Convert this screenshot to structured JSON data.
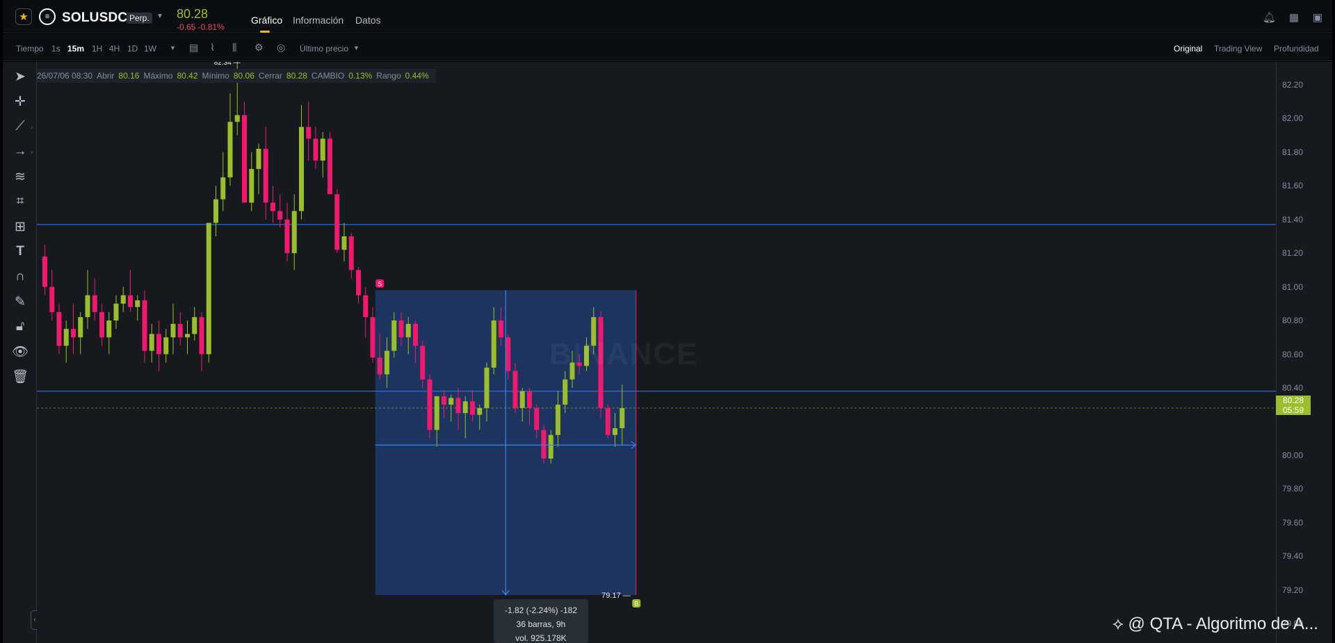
{
  "header": {
    "symbol": "SOLUSDC",
    "perp_label": "Perp.",
    "last_price": "80.28",
    "change": "-0.65 -0.81%",
    "tabs": [
      "Gráfico",
      "Información",
      "Datos"
    ]
  },
  "toolbar": {
    "time_label": "Tiempo",
    "intervals": [
      "1s",
      "15m",
      "1H",
      "4H",
      "1D",
      "1W"
    ],
    "active_interval": "15m",
    "price_type": "Último precio",
    "views": [
      "Original",
      "Trading View",
      "Profundidad"
    ],
    "active_view": "Original"
  },
  "legend": {
    "datetime": "26/07/06 08:30",
    "open_label": "Abrir",
    "open": "80.16",
    "high_label": "Máximo",
    "high": "80.42",
    "low_label": "Mínimo",
    "low": "80.06",
    "close_label": "Cerrar",
    "close": "80.28",
    "change_label": "CAMBIO",
    "change": "0.13%",
    "range_label": "Rango",
    "range": "0.44%"
  },
  "price_axis": {
    "ticks": [
      "82.20",
      "82.00",
      "81.80",
      "81.60",
      "81.40",
      "81.20",
      "81.00",
      "80.80",
      "80.60",
      "80.40",
      "80.00",
      "79.80",
      "79.60",
      "79.40",
      "79.20",
      "79.00"
    ],
    "current_price": "80.28",
    "countdown": "05:59"
  },
  "chart_data": {
    "type": "candlestick",
    "symbol": "SOLUSDC",
    "interval": "15m",
    "ylim": [
      79.0,
      82.3
    ],
    "colors": {
      "up": "#9bbf2a",
      "down": "#f0196e",
      "line": "#2f6bd6",
      "box": "#1f3a6b"
    },
    "candles": [
      [
        81.18,
        81.25,
        80.95,
        81.0
      ],
      [
        81.0,
        81.1,
        80.8,
        80.85
      ],
      [
        80.85,
        80.9,
        80.6,
        80.65
      ],
      [
        80.65,
        80.8,
        80.55,
        80.75
      ],
      [
        80.75,
        80.9,
        80.6,
        80.7
      ],
      [
        80.7,
        80.85,
        80.6,
        80.82
      ],
      [
        80.82,
        81.1,
        80.75,
        80.95
      ],
      [
        80.95,
        81.05,
        80.8,
        80.85
      ],
      [
        80.85,
        80.9,
        80.65,
        80.7
      ],
      [
        80.7,
        80.85,
        80.6,
        80.8
      ],
      [
        80.8,
        80.95,
        80.75,
        80.9
      ],
      [
        80.9,
        81.0,
        80.85,
        80.95
      ],
      [
        80.95,
        81.1,
        80.85,
        80.88
      ],
      [
        80.88,
        80.95,
        80.8,
        80.92
      ],
      [
        80.92,
        80.98,
        80.55,
        80.62
      ],
      [
        80.62,
        80.78,
        80.55,
        80.72
      ],
      [
        80.72,
        80.8,
        80.5,
        80.6
      ],
      [
        80.6,
        80.75,
        80.55,
        80.7
      ],
      [
        80.7,
        80.9,
        80.6,
        80.78
      ],
      [
        80.78,
        80.85,
        80.65,
        80.7
      ],
      [
        80.7,
        80.8,
        80.6,
        80.72
      ],
      [
        80.72,
        80.88,
        80.68,
        80.82
      ],
      [
        80.82,
        80.85,
        80.5,
        80.6
      ],
      [
        80.6,
        81.0,
        80.55,
        81.38
      ],
      [
        81.38,
        81.6,
        81.3,
        81.52
      ],
      [
        81.52,
        81.8,
        81.45,
        81.65
      ],
      [
        81.65,
        82.15,
        81.6,
        81.98
      ],
      [
        81.98,
        82.34,
        81.9,
        82.02
      ],
      [
        82.02,
        82.1,
        81.5,
        81.5
      ],
      [
        81.5,
        81.8,
        81.45,
        81.7
      ],
      [
        81.7,
        81.85,
        81.55,
        81.82
      ],
      [
        81.82,
        81.95,
        81.4,
        81.5
      ],
      [
        81.5,
        81.6,
        81.38,
        81.45
      ],
      [
        81.45,
        81.55,
        81.35,
        81.4
      ],
      [
        81.4,
        81.5,
        81.15,
        81.2
      ],
      [
        81.2,
        81.55,
        81.1,
        81.45
      ],
      [
        81.45,
        82.08,
        81.4,
        81.95
      ],
      [
        81.95,
        82.1,
        81.75,
        81.88
      ],
      [
        81.88,
        81.95,
        81.7,
        81.75
      ],
      [
        81.75,
        81.92,
        81.65,
        81.88
      ],
      [
        81.88,
        81.92,
        81.55,
        81.55
      ],
      [
        81.55,
        81.58,
        81.2,
        81.22
      ],
      [
        81.22,
        81.38,
        81.15,
        81.3
      ],
      [
        81.3,
        81.32,
        81.05,
        81.1
      ],
      [
        81.1,
        81.12,
        80.9,
        80.95
      ],
      [
        80.95,
        81.0,
        80.7,
        80.82
      ],
      [
        80.82,
        80.88,
        80.55,
        80.58
      ],
      [
        80.58,
        80.72,
        80.45,
        80.48
      ],
      [
        80.48,
        80.7,
        80.4,
        80.62
      ],
      [
        80.62,
        80.85,
        80.58,
        80.8
      ],
      [
        80.8,
        80.85,
        80.65,
        80.7
      ],
      [
        80.7,
        80.82,
        80.6,
        80.78
      ],
      [
        80.78,
        80.8,
        80.55,
        80.65
      ],
      [
        80.65,
        80.68,
        80.4,
        80.45
      ],
      [
        80.45,
        80.48,
        80.1,
        80.15
      ],
      [
        80.15,
        80.35,
        80.05,
        80.35
      ],
      [
        80.35,
        80.38,
        80.22,
        80.3
      ],
      [
        80.3,
        80.36,
        80.2,
        80.34
      ],
      [
        80.34,
        80.4,
        80.15,
        80.25
      ],
      [
        80.25,
        80.35,
        80.1,
        80.32
      ],
      [
        80.32,
        80.38,
        80.2,
        80.24
      ],
      [
        80.24,
        80.3,
        80.15,
        80.28
      ],
      [
        80.28,
        80.55,
        80.2,
        80.52
      ],
      [
        80.52,
        80.88,
        80.48,
        80.8
      ],
      [
        80.8,
        80.88,
        80.65,
        80.7
      ],
      [
        80.7,
        80.72,
        80.45,
        80.5
      ],
      [
        80.5,
        80.55,
        80.25,
        80.28
      ],
      [
        80.28,
        80.4,
        80.2,
        80.38
      ],
      [
        80.38,
        80.4,
        80.18,
        80.28
      ],
      [
        80.28,
        80.3,
        80.1,
        80.15
      ],
      [
        80.15,
        80.18,
        79.95,
        79.98
      ],
      [
        79.98,
        80.15,
        79.95,
        80.12
      ],
      [
        80.12,
        80.38,
        80.05,
        80.3
      ],
      [
        80.3,
        80.5,
        80.25,
        80.45
      ],
      [
        80.45,
        80.62,
        80.4,
        80.55
      ],
      [
        80.55,
        80.6,
        80.48,
        80.53
      ],
      [
        80.53,
        80.7,
        80.5,
        80.65
      ],
      [
        80.65,
        80.88,
        80.6,
        80.82
      ],
      [
        80.82,
        80.85,
        80.22,
        80.28
      ],
      [
        80.28,
        80.3,
        80.1,
        80.12
      ],
      [
        80.12,
        80.25,
        80.05,
        80.16
      ],
      [
        80.16,
        80.42,
        80.06,
        80.28
      ]
    ],
    "horizontal_lines": [
      81.37,
      80.38
    ],
    "current_price_line": 80.28,
    "measure": {
      "bar_from": 47,
      "bar_to": 83,
      "price_top": 80.98,
      "price_bottom": 79.17,
      "label_low": "79.17",
      "summary_1": "-1.82 (-2.24%) -182",
      "summary_2": "36 barras, 9h",
      "summary_3": "vol. 925.178K"
    },
    "markers": [
      {
        "bar": 47,
        "price": 81.02,
        "label": "S"
      },
      {
        "bar": 83,
        "price": 79.12,
        "label": "B"
      }
    ],
    "high_marker_label": "82.34"
  },
  "watermark": "BINANCE",
  "credit": "@ QTA - Algoritmo de A..."
}
